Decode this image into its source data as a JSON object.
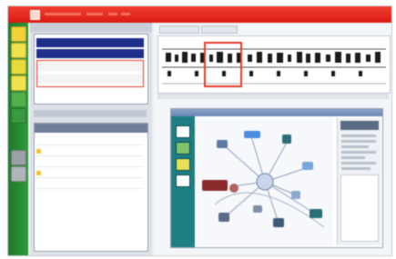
{
  "window": {
    "title": "",
    "title_color": "#e02a1c"
  },
  "toolbar": {
    "tools": [
      {
        "icon": "folder-icon",
        "color": "#f2d13a"
      },
      {
        "icon": "tool-icon",
        "color": "#f0e04a"
      },
      {
        "icon": "tool-icon",
        "color": "#e9d93c"
      },
      {
        "icon": "tool-icon",
        "color": "#f3e24e"
      },
      {
        "icon": "tool-icon",
        "color": "#52b14a"
      },
      {
        "icon": "tool-icon",
        "color": "#3a9a3f"
      },
      {
        "icon": "tool-icon",
        "color": "#9aa0a6"
      },
      {
        "icon": "tool-icon",
        "color": "#b0b5bb"
      }
    ]
  },
  "left_panel": {
    "tree_rows": [
      {
        "label": "",
        "selected": true
      },
      {
        "label": "",
        "selected": true
      },
      {
        "label": "",
        "selected": false
      },
      {
        "label": "",
        "selected": false
      }
    ],
    "prop_rows": [
      {
        "label": ""
      },
      {
        "label": ""
      },
      {
        "label": ""
      },
      {
        "label": ""
      },
      {
        "label": ""
      }
    ]
  },
  "tabs": [
    {
      "label": ""
    },
    {
      "label": ""
    }
  ],
  "diagram": {
    "node_colors": [
      "#4c8de0",
      "#8b2a2a",
      "#2c6e78",
      "#7aa6d9",
      "#5a6b86"
    ]
  }
}
